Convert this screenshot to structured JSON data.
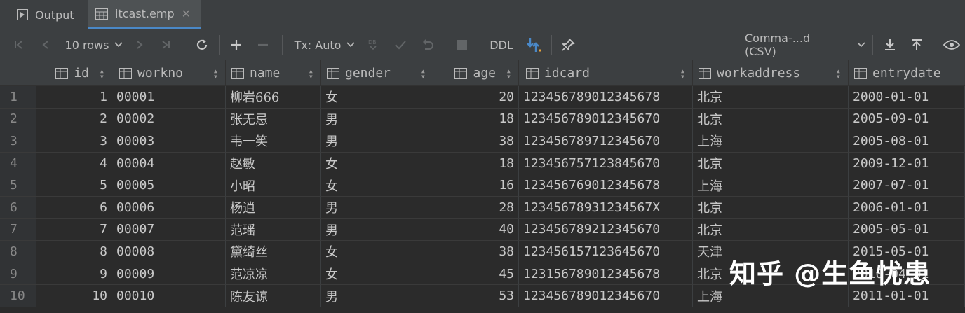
{
  "tabs": [
    {
      "label": "Output",
      "icon": "play-icon"
    },
    {
      "label": "itcast.emp",
      "icon": "table-icon",
      "active": true
    }
  ],
  "toolbar": {
    "rows_label": "10 rows",
    "tx_label": "Tx: Auto",
    "ddl_label": "DDL",
    "format_label": "Comma-...d (CSV)"
  },
  "columns": [
    "id",
    "workno",
    "name",
    "gender",
    "age",
    "idcard",
    "workaddress",
    "entrydate"
  ],
  "rows": [
    {
      "n": "1",
      "id": "1",
      "workno": "00001",
      "name": "柳岩666",
      "gender": "女",
      "age": "20",
      "idcard": "123456789012345678",
      "workaddress": "北京",
      "entrydate": "2000-01-01"
    },
    {
      "n": "2",
      "id": "2",
      "workno": "00002",
      "name": "张无忌",
      "gender": "男",
      "age": "18",
      "idcard": "123456789012345670",
      "workaddress": "北京",
      "entrydate": "2005-09-01"
    },
    {
      "n": "3",
      "id": "3",
      "workno": "00003",
      "name": "韦一笑",
      "gender": "男",
      "age": "38",
      "idcard": "123456789712345670",
      "workaddress": "上海",
      "entrydate": "2005-08-01"
    },
    {
      "n": "4",
      "id": "4",
      "workno": "00004",
      "name": "赵敏",
      "gender": "女",
      "age": "18",
      "idcard": "123456757123845670",
      "workaddress": "北京",
      "entrydate": "2009-12-01"
    },
    {
      "n": "5",
      "id": "5",
      "workno": "00005",
      "name": "小昭",
      "gender": "女",
      "age": "16",
      "idcard": "123456769012345678",
      "workaddress": "上海",
      "entrydate": "2007-07-01"
    },
    {
      "n": "6",
      "id": "6",
      "workno": "00006",
      "name": "杨逍",
      "gender": "男",
      "age": "28",
      "idcard": "12345678931234567X",
      "workaddress": "北京",
      "entrydate": "2006-01-01"
    },
    {
      "n": "7",
      "id": "7",
      "workno": "00007",
      "name": "范瑶",
      "gender": "男",
      "age": "40",
      "idcard": "123456789212345670",
      "workaddress": "北京",
      "entrydate": "2005-05-01"
    },
    {
      "n": "8",
      "id": "8",
      "workno": "00008",
      "name": "黛绮丝",
      "gender": "女",
      "age": "38",
      "idcard": "123456157123645670",
      "workaddress": "天津",
      "entrydate": "2015-05-01"
    },
    {
      "n": "9",
      "id": "9",
      "workno": "00009",
      "name": "范凉凉",
      "gender": "女",
      "age": "45",
      "idcard": "123156789012345678",
      "workaddress": "北京",
      "entrydate": "2010-04-01"
    },
    {
      "n": "10",
      "id": "10",
      "workno": "00010",
      "name": "陈友谅",
      "gender": "男",
      "age": "53",
      "idcard": "123456789012345670",
      "workaddress": "上海",
      "entrydate": "2011-01-01"
    }
  ],
  "watermark": "知乎 @生鱼忧患",
  "colors": {
    "background": "#2b2b2b",
    "toolbar": "#3c3f41",
    "accent": "#4a88c7"
  }
}
